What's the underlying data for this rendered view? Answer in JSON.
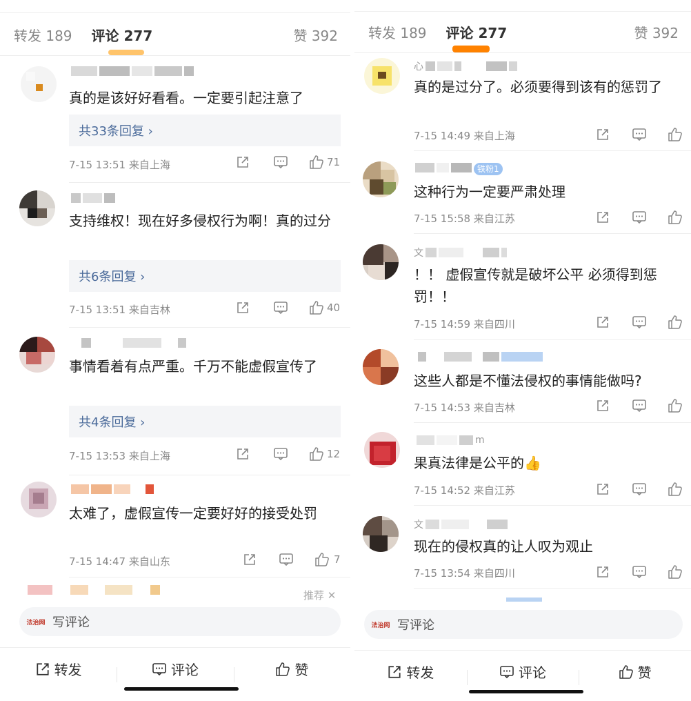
{
  "left": {
    "tabs": {
      "repost": "转发 189",
      "comments": "评论 277",
      "likes": "赞 392"
    },
    "comments": [
      {
        "text": "真的是该好好看看。一定要引起注意了",
        "replies": "共33条回复 ›",
        "time": "7-15 13:51",
        "loc": "来自上海",
        "likes": "71"
      },
      {
        "text": "支持维权！现在好多侵权行为啊！真的过分",
        "replies": "共6条回复 ›",
        "time": "7-15 13:51",
        "loc": "来自吉林",
        "likes": "40"
      },
      {
        "text": "事情看着有点严重。千万不能虚假宣传了",
        "replies": "共4条回复 ›",
        "time": "7-15 13:53",
        "loc": "来自上海",
        "likes": "12"
      },
      {
        "text": "太难了，虚假宣传一定要好好的接受处罚",
        "time": "7-15 14:47",
        "loc": "来自山东",
        "likes": "7"
      }
    ],
    "recommend": "推荐 ✕",
    "composer_placeholder": "写评论",
    "logo_text": "法治网",
    "bottom": {
      "repost": "转发",
      "comment": "评论",
      "like": "赞"
    }
  },
  "right": {
    "tabs": {
      "repost": "转发 189",
      "comments": "评论 277",
      "likes": "赞 392"
    },
    "comments": [
      {
        "name_suffix": "心",
        "text": "真的是过分了。必须要得到该有的惩罚了",
        "time": "7-15 14:49",
        "loc": "来自上海"
      },
      {
        "badge": "铁粉1",
        "text": "这种行为一定要严肃处理",
        "time": "7-15 15:58",
        "loc": "来自江苏"
      },
      {
        "name_suffix": "文",
        "text": "！！ 虚假宣传就是破坏公平 必须得到惩罚！！",
        "time": "7-15 14:59",
        "loc": "来自四川"
      },
      {
        "text": "这些人都是不懂法侵权的事情能做吗?",
        "time": "7-15 14:53",
        "loc": "来自吉林"
      },
      {
        "name_suffix": "m",
        "text": "果真法律是公平的👍",
        "time": "7-15 14:52",
        "loc": "来自江苏"
      },
      {
        "name_suffix": "文",
        "text": "现在的侵权真的让人叹为观止",
        "time": "7-15 13:54",
        "loc": "来自四川"
      }
    ],
    "composer_placeholder": "写评论",
    "logo_text": "法治网",
    "bottom": {
      "repost": "转发",
      "comment": "评论",
      "like": "赞"
    }
  },
  "colors": {
    "accent_orange": "#ff8200",
    "underline_left": "#ffb14d",
    "reply_link": "#4a6a9a",
    "text_gray": "#888888"
  }
}
